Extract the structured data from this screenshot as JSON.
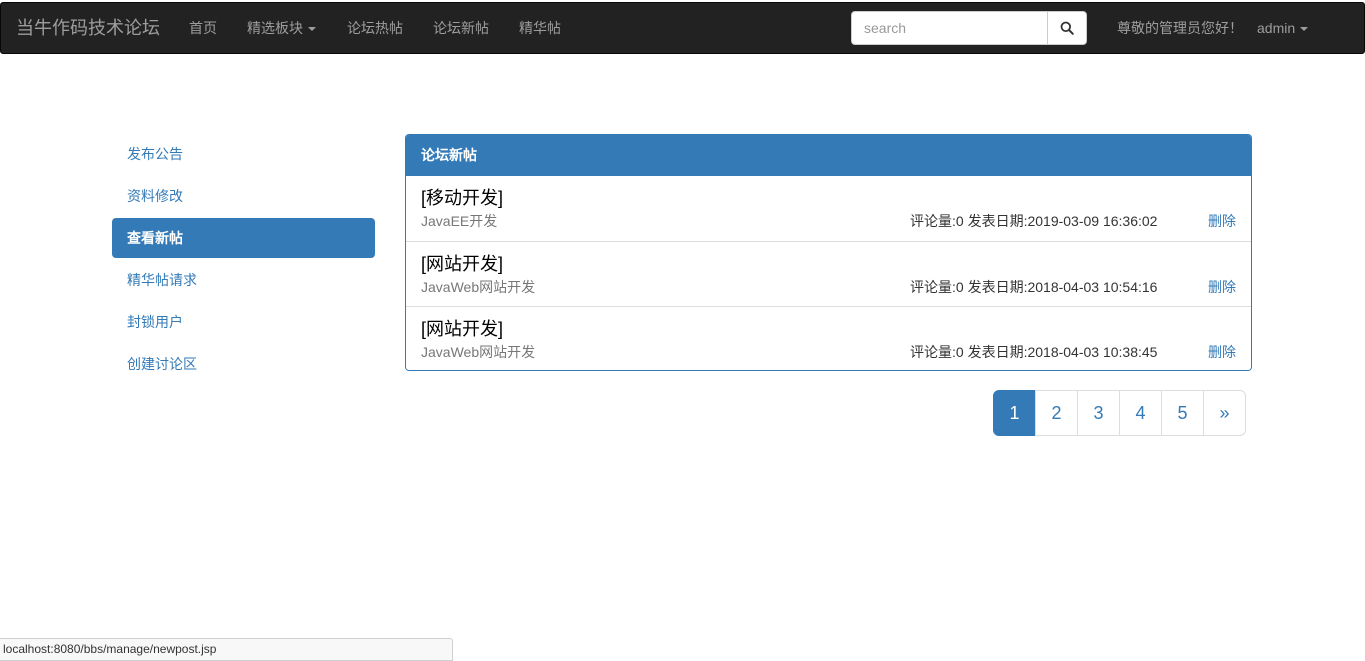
{
  "navbar": {
    "brand": "当牛作码技术论坛",
    "links": [
      "首页",
      "精选板块",
      "论坛热帖",
      "论坛新帖",
      "精华帖"
    ],
    "search_placeholder": "search",
    "greeting": "尊敬的管理员您好！",
    "user": "admin",
    "colors": {
      "background": "#222222",
      "text": "#9d9d9d"
    }
  },
  "sidebar": {
    "items": [
      "发布公告",
      "资料修改",
      "查看新帖",
      "精华帖请求",
      "封锁用户",
      "创建讨论区"
    ],
    "active_index": 2
  },
  "panel": {
    "heading": "论坛新帖",
    "posts": [
      {
        "title": "[移动开发]",
        "category": "JavaEE开发",
        "meta": "评论量:0 发表日期:2019-03-09 16:36:02",
        "action": "删除"
      },
      {
        "title": "[网站开发]",
        "category": "JavaWeb网站开发",
        "meta": "评论量:0 发表日期:2018-04-03 10:54:16",
        "action": "删除"
      },
      {
        "title": "[网站开发]",
        "category": "JavaWeb网站开发",
        "meta": "评论量:0 发表日期:2018-04-03 10:38:45",
        "action": "删除"
      }
    ],
    "accent_color": "#337ab7"
  },
  "pagination": {
    "pages": [
      "1",
      "2",
      "3",
      "4",
      "5"
    ],
    "active": "1",
    "next": "»"
  },
  "status_bar": {
    "url": "localhost:8080/bbs/manage/newpost.jsp"
  }
}
